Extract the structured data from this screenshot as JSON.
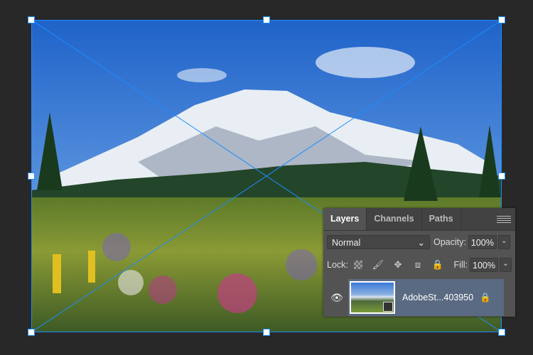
{
  "canvas": {
    "image_description_icon": "landscape-photo"
  },
  "layers_panel": {
    "tabs": [
      {
        "label": "Layers",
        "active": true
      },
      {
        "label": "Channels",
        "active": false
      },
      {
        "label": "Paths",
        "active": false
      }
    ],
    "blend_mode": "Normal",
    "opacity_label": "Opacity:",
    "opacity_value": "100%",
    "lock_label": "Lock:",
    "fill_label": "Fill:",
    "fill_value": "100%",
    "layer": {
      "name": "AdobeSt...403950",
      "visible": true,
      "locked": true,
      "smart_object": true
    }
  },
  "colors": {
    "accent": "#1a8cff",
    "panel": "#535353",
    "selected_layer": "#5a6a82"
  }
}
